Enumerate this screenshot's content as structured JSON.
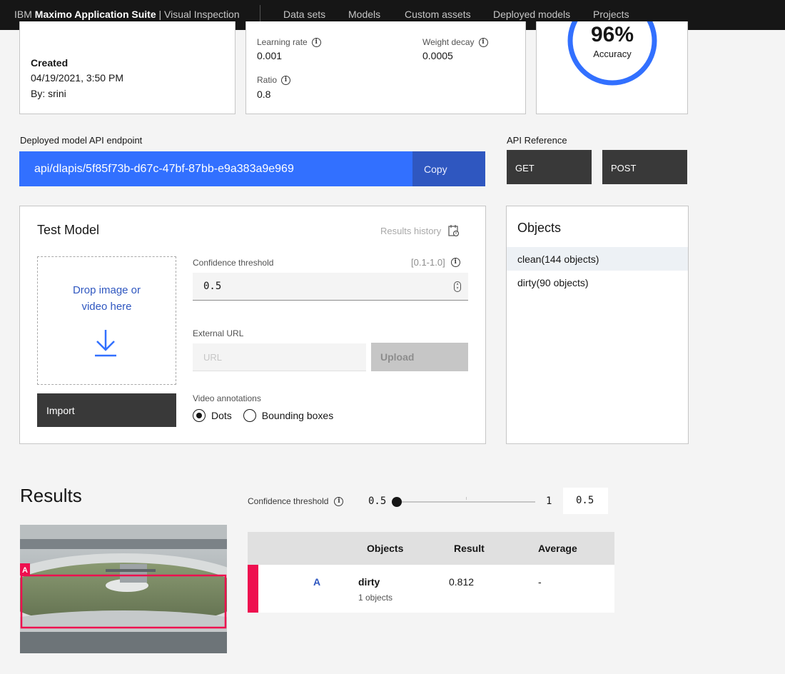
{
  "topnav": {
    "brand_prefix": "IBM",
    "brand_bold": "Maximo Application Suite",
    "brand_suffix": "| Visual Inspection",
    "items": [
      "Data sets",
      "Models",
      "Custom assets",
      "Deployed models",
      "Projects"
    ]
  },
  "model_info": {
    "created_label": "Created",
    "created_date": "04/19/2021, 3:50 PM",
    "created_by": "By: srini"
  },
  "hyperparams": {
    "learning_rate_label": "Learning rate",
    "learning_rate": "0.001",
    "weight_decay_label": "Weight decay",
    "weight_decay": "0.0005",
    "ratio_label": "Ratio",
    "ratio": "0.8"
  },
  "accuracy": {
    "value": "96%",
    "label": "Accuracy",
    "fraction": 0.96
  },
  "endpoint": {
    "label": "Deployed model API endpoint",
    "value": "api/dlapis/5f85f73b-d67c-47bf-87bb-e9a383a9e969",
    "copy_label": "Copy"
  },
  "api_reference": {
    "label": "API Reference",
    "get_label": "GET",
    "post_label": "POST"
  },
  "test_model": {
    "title": "Test Model",
    "results_history": "Results history",
    "drop_line1": "Drop image or",
    "drop_line2": "video here",
    "import_label": "Import",
    "confidence_label": "Confidence threshold",
    "confidence_range": "[0.1-1.0]",
    "confidence_value": "0.5",
    "external_url_label": "External URL",
    "url_placeholder": "URL",
    "upload_label": "Upload",
    "video_annotations_label": "Video annotations",
    "radio_dots": "Dots",
    "radio_bbox": "Bounding boxes"
  },
  "objects": {
    "title": "Objects",
    "items": [
      "clean(144 objects)",
      "dirty(90 objects)"
    ]
  },
  "results": {
    "title": "Results",
    "confidence_label": "Confidence threshold",
    "slider_min": "0.5",
    "slider_max": "1",
    "slider_value": "0.5",
    "table_headers": [
      "Objects",
      "Result",
      "Average"
    ],
    "rows": [
      {
        "tag": "A",
        "object": "dirty",
        "count": "1 objects",
        "result": "0.812",
        "average": "-"
      }
    ],
    "thumbnail_tag": "A"
  },
  "colors": {
    "accent": "#3270ff",
    "accent_dark": "#2f57c0",
    "status_red": "#ee0f4f",
    "nav_bg": "#161616"
  }
}
